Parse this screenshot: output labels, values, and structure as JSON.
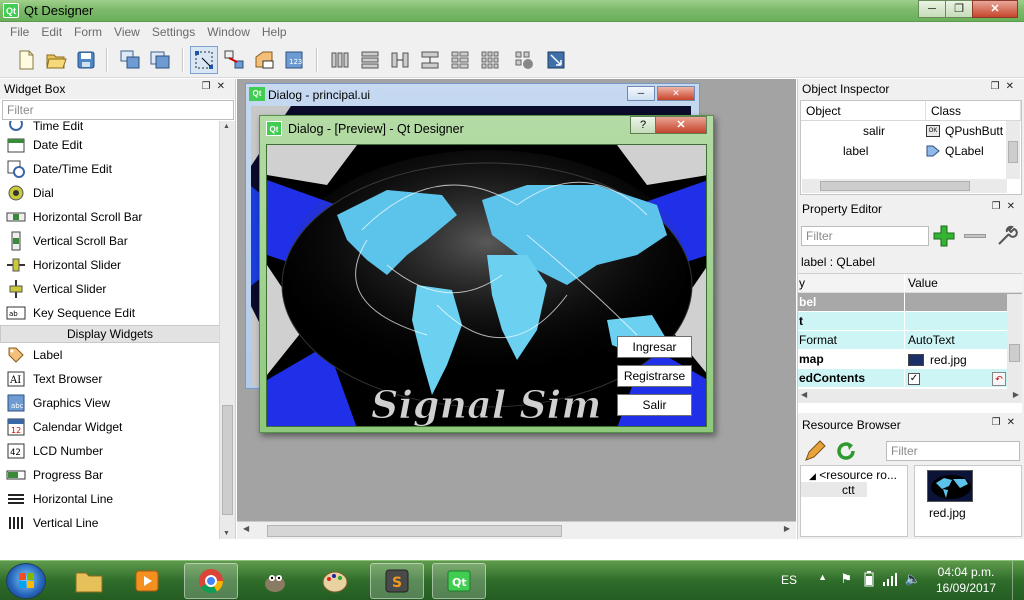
{
  "window": {
    "title": "Qt Designer",
    "logo_text": "Qt"
  },
  "menu": [
    "File",
    "Edit",
    "Form",
    "View",
    "Settings",
    "Window",
    "Help"
  ],
  "widget_box": {
    "title": "Widget Box",
    "filter_placeholder": "Filter",
    "items_top": [
      "Time Edit",
      "Date Edit",
      "Date/Time Edit",
      "Dial",
      "Horizontal Scroll Bar",
      "Vertical Scroll Bar",
      "Horizontal Slider",
      "Vertical Slider",
      "Key Sequence Edit"
    ],
    "category": "Display Widgets",
    "items_display": [
      "Label",
      "Text Browser",
      "Graphics View",
      "Calendar Widget",
      "LCD Number",
      "Progress Bar",
      "Horizontal Line",
      "Vertical Line"
    ]
  },
  "subwindow": {
    "title": "Dialog - principal.ui"
  },
  "preview": {
    "title": "Dialog - [Preview] - Qt Designer",
    "help_btn": "?",
    "buttons": {
      "ingresar": "Ingresar",
      "registrarse": "Registrarse",
      "salir": "Salir"
    },
    "logo_text": "Signal Sim"
  },
  "object_inspector": {
    "title": "Object Inspector",
    "col_object": "Object",
    "col_class": "Class",
    "rows": [
      {
        "object": "salir",
        "class": "QPushButt"
      },
      {
        "object": "label",
        "class": "QLabel"
      }
    ]
  },
  "property_editor": {
    "title": "Property Editor",
    "filter_placeholder": "Filter",
    "context": "label : QLabel",
    "col_property": "y",
    "col_value": "Value",
    "rows": [
      {
        "name": "bel",
        "value": "",
        "kind": "header"
      },
      {
        "name": "t",
        "value": "",
        "kind": "cyan"
      },
      {
        "name": "Format",
        "value": "AutoText",
        "kind": "cyan"
      },
      {
        "name": "map",
        "value": "red.jpg",
        "kind": "plain"
      },
      {
        "name": "edContents",
        "value": "",
        "kind": "check"
      }
    ]
  },
  "resource_browser": {
    "title": "Resource Browser",
    "filter_placeholder": "Filter",
    "tree_root": "<resource ro...",
    "tree_child": "ctt",
    "file": "red.jpg"
  },
  "taskbar": {
    "language": "ES",
    "time": "04:04 p.m.",
    "date": "16/09/2017"
  },
  "colors": {
    "title_green": "#7dba6b",
    "cyan_row": "#cdf5f5",
    "header_gray": "#a8a8a8"
  }
}
